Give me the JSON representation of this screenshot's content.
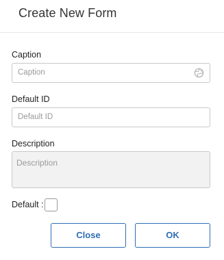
{
  "dialog": {
    "title": "Create New Form"
  },
  "form": {
    "caption": {
      "label": "Caption",
      "placeholder": "Caption",
      "icon": "globe-icon"
    },
    "default_id": {
      "label": "Default ID",
      "placeholder": "Default ID"
    },
    "description": {
      "label": "Description",
      "placeholder": "Description"
    },
    "default_flag": {
      "label": "Default :",
      "checked": false
    }
  },
  "buttons": {
    "close_label": "Close",
    "ok_label": "OK"
  },
  "colors": {
    "accent": "#2e6db4",
    "border": "#c8c8c8",
    "placeholder": "#999999"
  }
}
